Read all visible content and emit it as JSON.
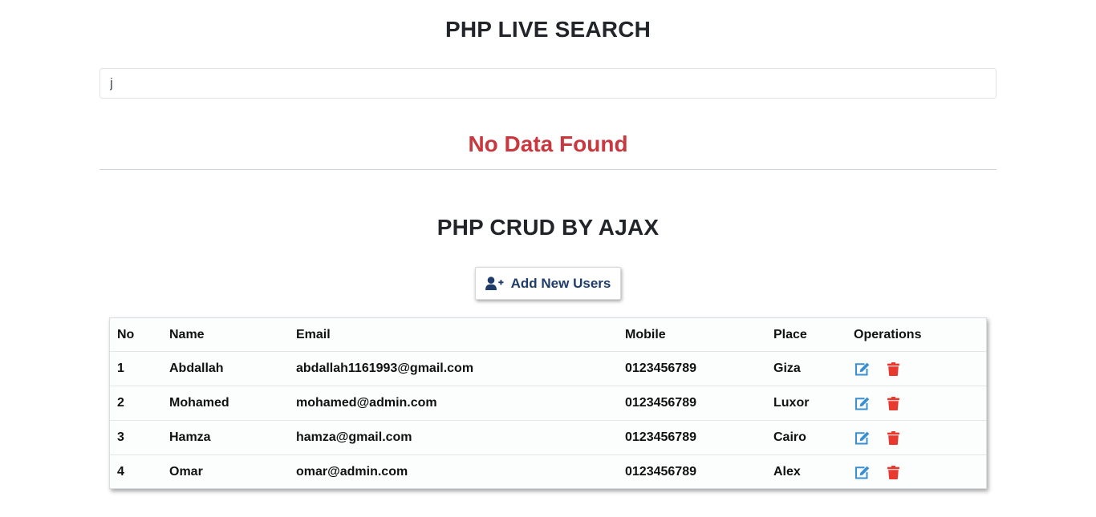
{
  "live_search": {
    "title": "PHP LIVE SEARCH",
    "input_value": "j",
    "no_data_text": "No Data Found"
  },
  "crud": {
    "title": "PHP CRUD BY AJAX",
    "add_button_label": "Add New Users",
    "add_button_icon": "user-plus-icon",
    "columns": [
      "No",
      "Name",
      "Email",
      "Mobile",
      "Place",
      "Operations"
    ],
    "rows": [
      {
        "no": "1",
        "name": "Abdallah",
        "email": "abdallah1161993@gmail.com",
        "mobile": "0123456789",
        "place": "Giza"
      },
      {
        "no": "2",
        "name": "Mohamed",
        "email": "mohamed@admin.com",
        "mobile": "0123456789",
        "place": "Luxor"
      },
      {
        "no": "3",
        "name": "Hamza",
        "email": "hamza@gmail.com",
        "mobile": "0123456789",
        "place": "Cairo"
      },
      {
        "no": "4",
        "name": "Omar",
        "email": "omar@admin.com",
        "mobile": "0123456789",
        "place": "Alex"
      }
    ],
    "edit_icon": "edit-icon",
    "delete_icon": "trash-icon"
  },
  "colors": {
    "no_data": "#c9383f",
    "button_text": "#1f3c6b",
    "edit_icon": "#3a8fd0",
    "delete_icon": "#e8392f"
  }
}
